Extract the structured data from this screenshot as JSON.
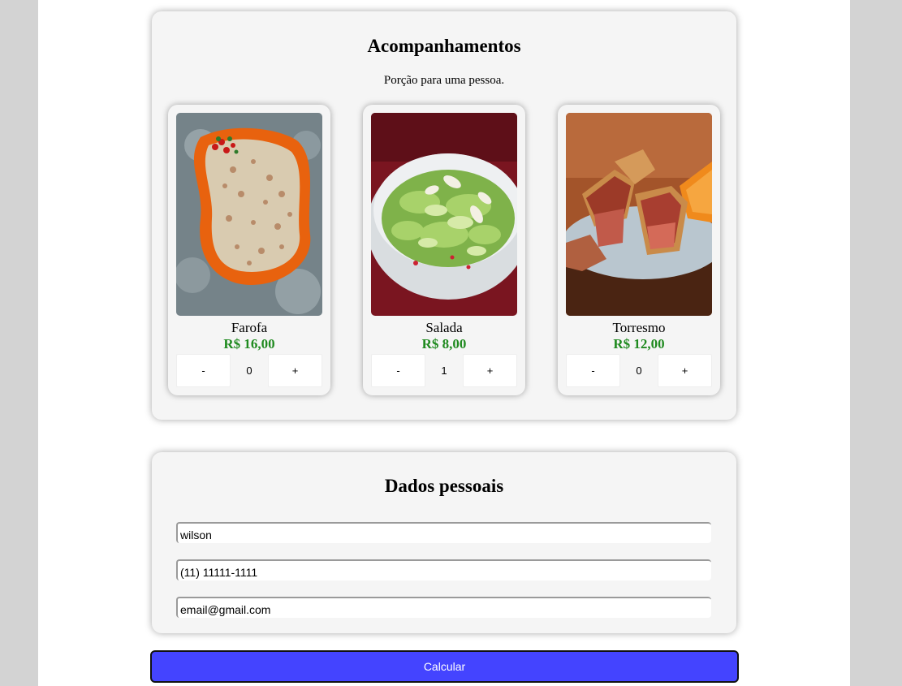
{
  "sides": {
    "title": "Acompanhamentos",
    "subtitle": "Porção para uma pessoa.",
    "items": [
      {
        "name": "Farofa",
        "price": "R$ 16,00",
        "minus": "-",
        "qty": "0",
        "plus": "+",
        "image": "farofa-photo"
      },
      {
        "name": "Salada",
        "price": "R$ 8,00",
        "minus": "-",
        "qty": "1",
        "plus": "+",
        "image": "salad-photo"
      },
      {
        "name": "Torresmo",
        "price": "R$ 12,00",
        "minus": "-",
        "qty": "0",
        "plus": "+",
        "image": "torresmo-photo"
      }
    ]
  },
  "personal": {
    "title": "Dados pessoais",
    "name_value": "wilson",
    "phone_value": "(11) 11111-1111",
    "email_value": "email@gmail.com"
  },
  "calculate_label": "Calcular",
  "colors": {
    "price": "#1f8a1f",
    "button": "#4444ff",
    "card": "#f5f5f5",
    "backdrop": "#d3d3d3"
  }
}
